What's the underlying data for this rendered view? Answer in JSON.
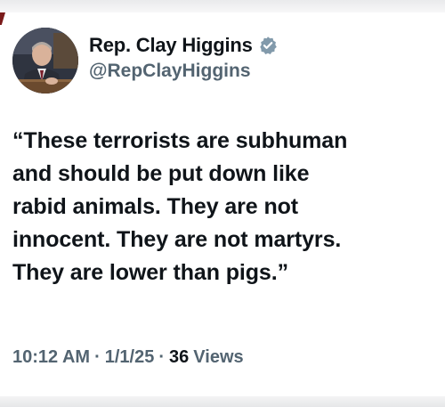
{
  "author": {
    "display_name": "Rep. Clay Higgins",
    "handle": "@RepClayHiggins",
    "verified": true,
    "verified_color": "#829aab"
  },
  "tweet": {
    "text_lines": [
      "“These terrorists are subhuman",
      "and should be put down like",
      "rabid animals. They are not",
      "innocent. They are not martyrs.",
      "They are lower than pigs.”"
    ]
  },
  "meta": {
    "time": "10:12 AM",
    "separator": "·",
    "date": "1/1/25",
    "views_count": "36",
    "views_label": "Views"
  },
  "icons": {
    "verified": "verified-badge-icon",
    "avatar": "profile-photo"
  }
}
